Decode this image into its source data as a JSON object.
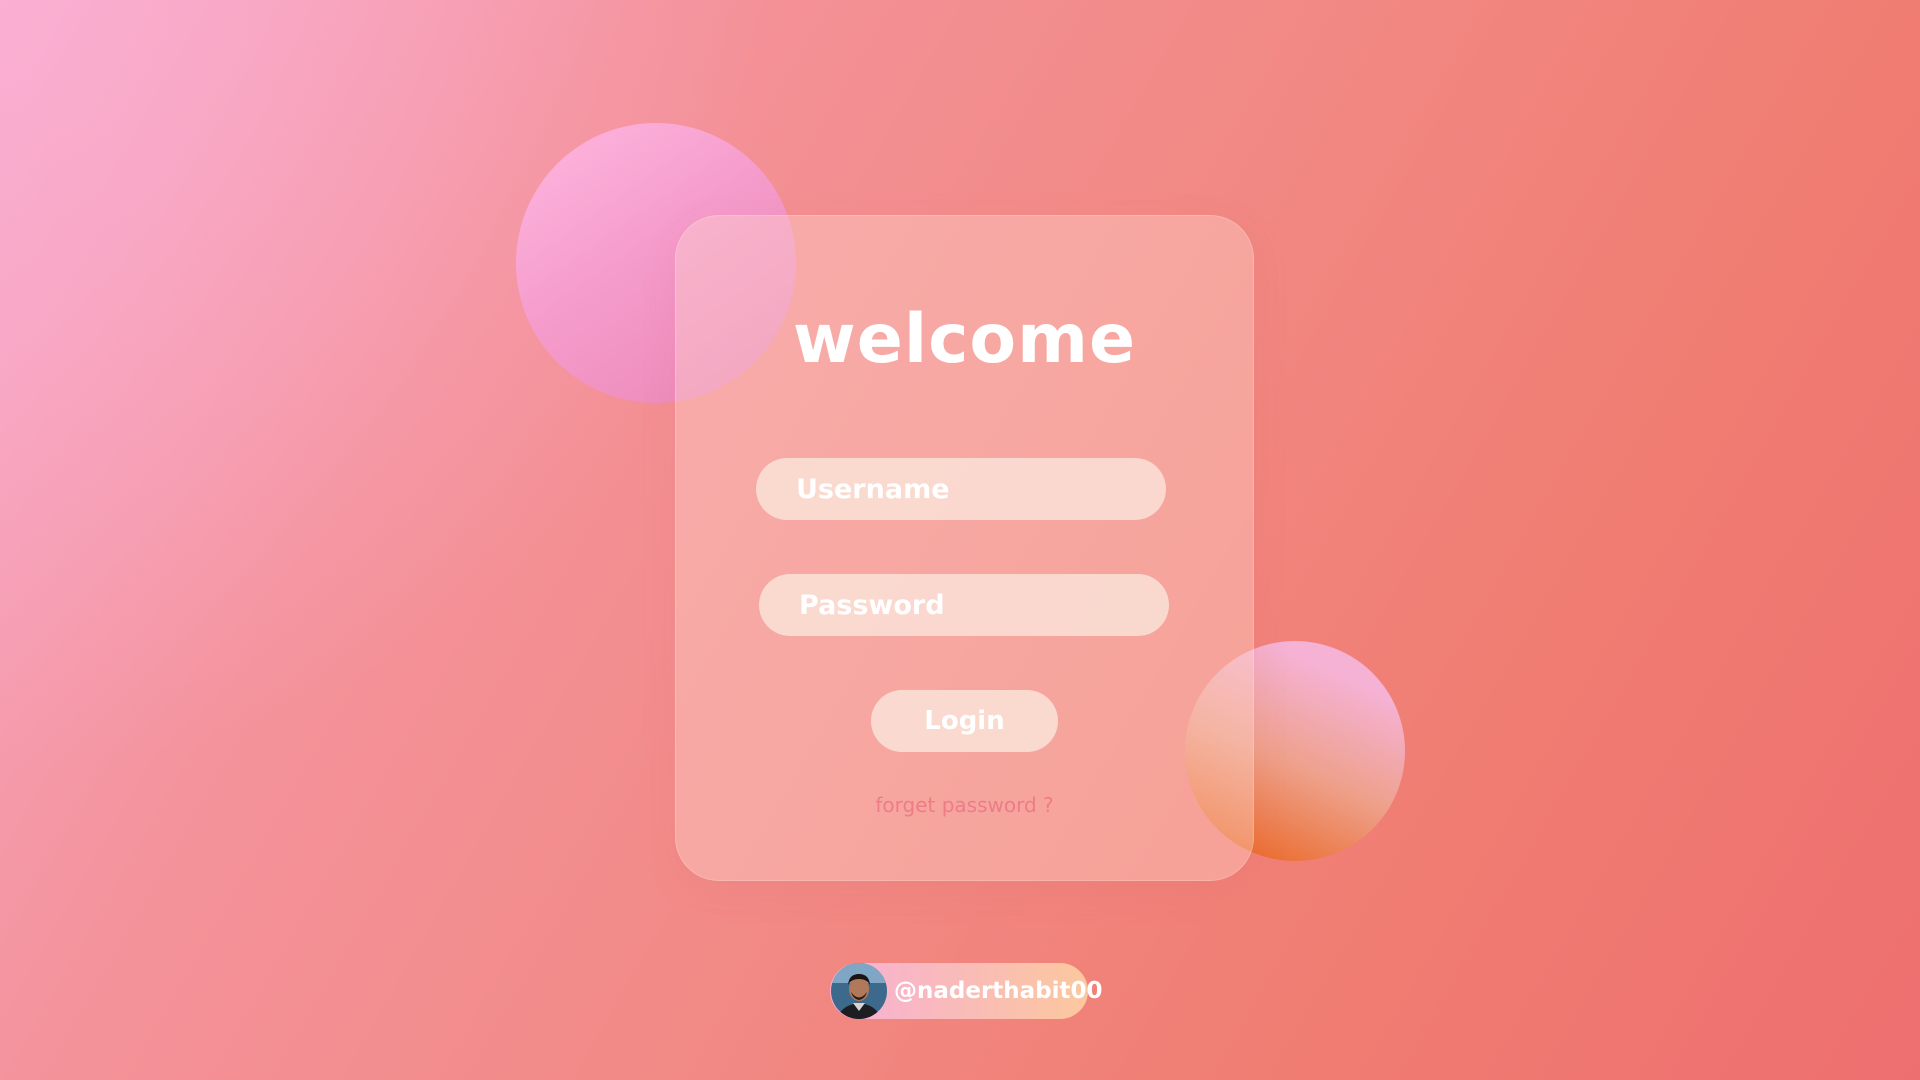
{
  "login_card": {
    "title": "welcome",
    "username_field": {
      "placeholder": "Username",
      "value": ""
    },
    "password_field": {
      "placeholder": "Password",
      "value": ""
    },
    "login_button_label": "Login",
    "forget_password_label": "forget password ?"
  },
  "author_badge": {
    "handle": "@naderthabit00",
    "avatar_icon": "user-avatar-photo"
  },
  "colors": {
    "background_start": "#f8aacc",
    "background_end": "#ee6f70",
    "text": "#ffffff",
    "link": "#ee7c88"
  }
}
